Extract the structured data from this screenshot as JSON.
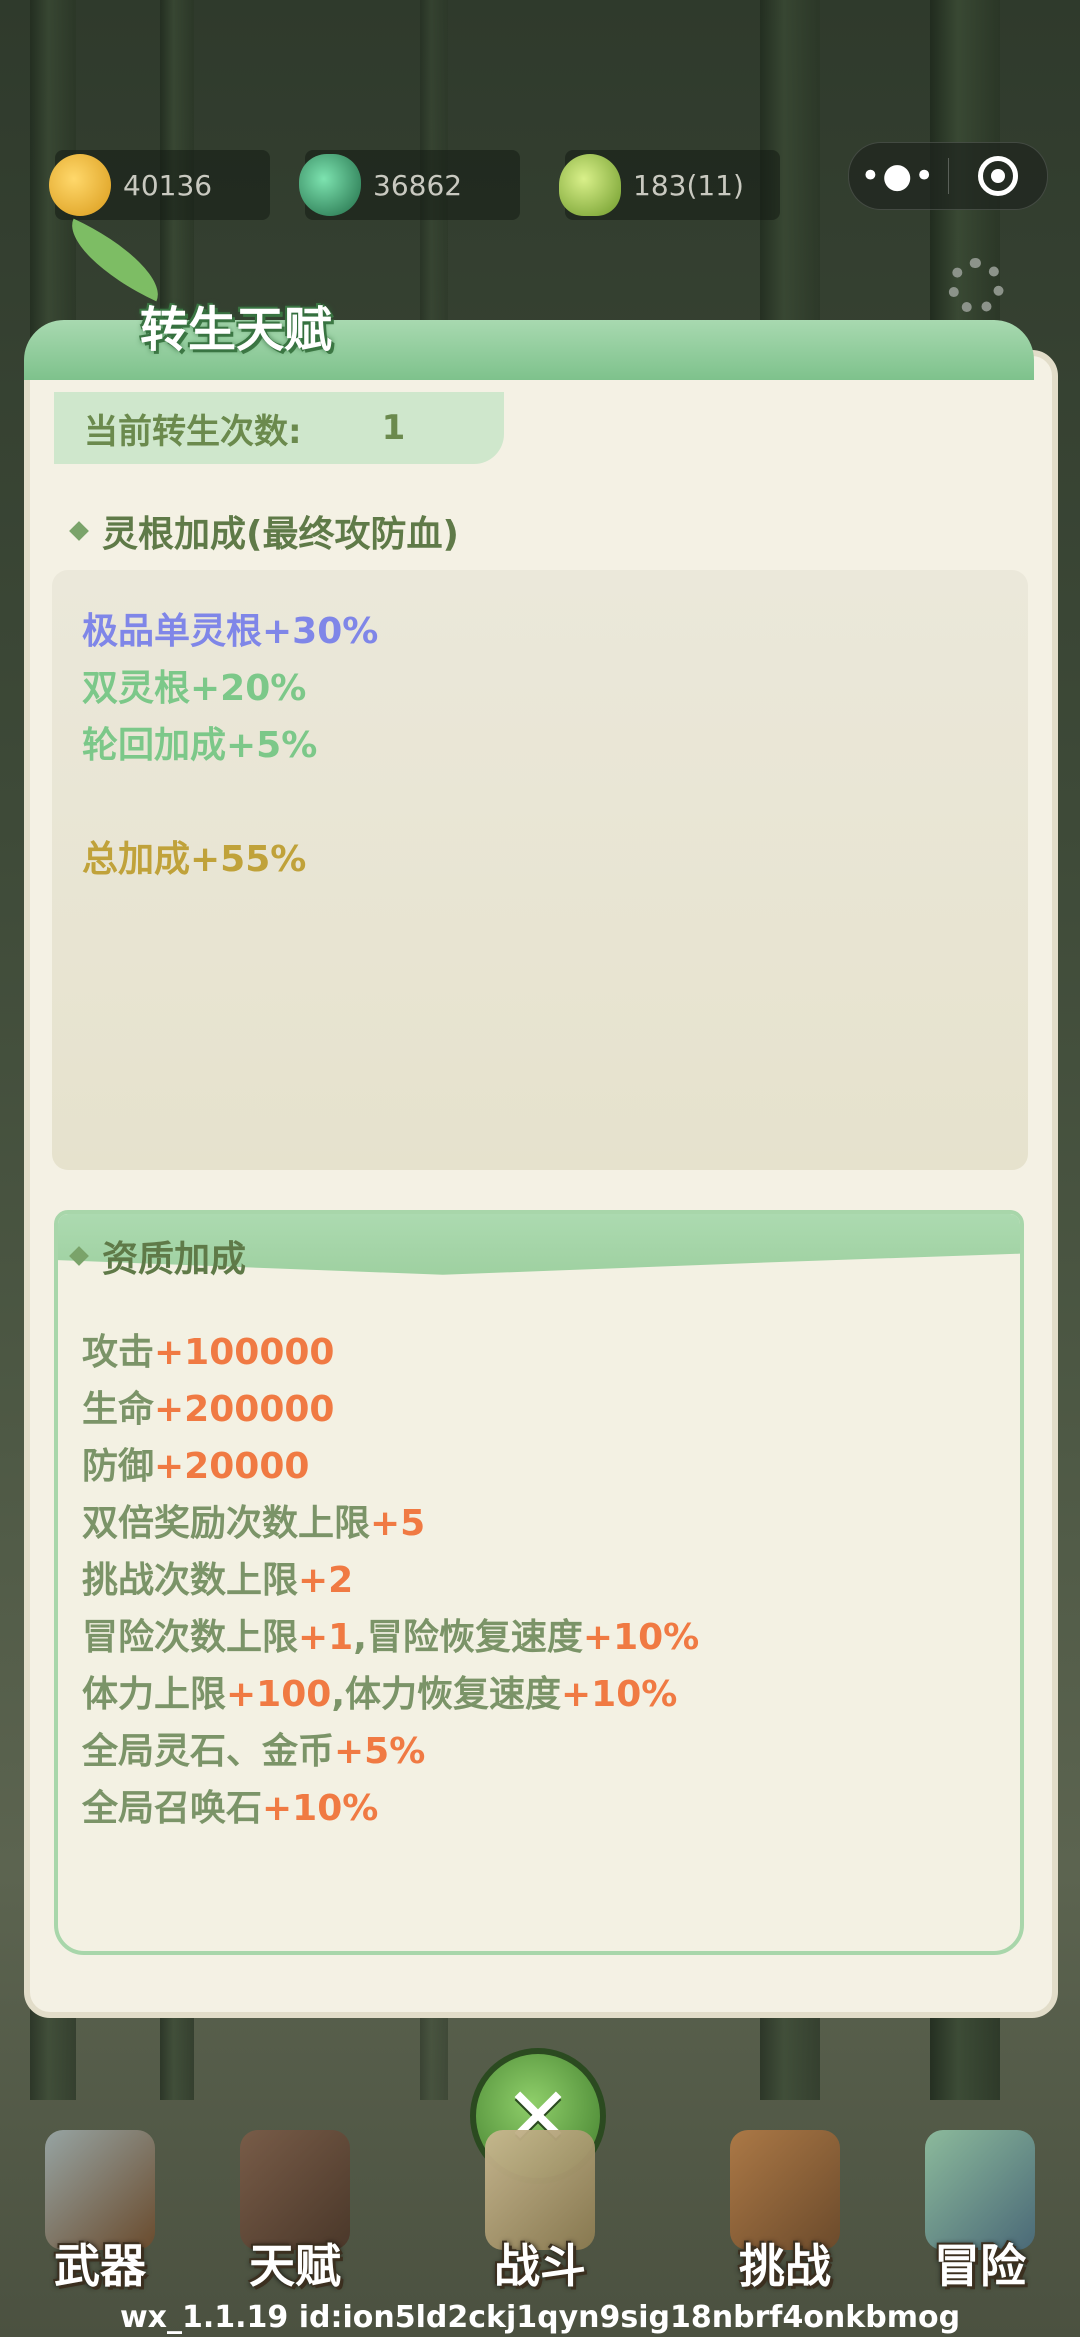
{
  "resources": {
    "gold": "40136",
    "spirit_stone": "36862",
    "bamboo": "183(11)"
  },
  "panel": {
    "title": "转生天赋",
    "rebirth_label": "当前转生次数:",
    "rebirth_value": "1",
    "root_section": {
      "heading": "灵根加成(最终攻防血)",
      "lines": [
        {
          "name": "极品单灵根",
          "bonus": "+30%",
          "color": "#7f86e8"
        },
        {
          "name": "双灵根",
          "bonus": "+20%",
          "color": "#7cc889"
        },
        {
          "name": "轮回加成",
          "bonus": "+5%",
          "color": "#7cc889"
        }
      ],
      "total": {
        "name": "总加成",
        "bonus": "+55%",
        "color": "#c0a23a"
      }
    },
    "aptitude_section": {
      "heading": "资质加成",
      "lines": [
        {
          "parts": [
            "攻击",
            "+100000"
          ]
        },
        {
          "parts": [
            "生命",
            "+200000"
          ]
        },
        {
          "parts": [
            "防御",
            "+20000"
          ]
        },
        {
          "parts": [
            "双倍奖励次数上限",
            "+5"
          ]
        },
        {
          "parts": [
            "挑战次数上限",
            "+2"
          ]
        },
        {
          "parts": [
            "冒险次数上限",
            "+1",
            ",冒险恢复速度",
            "+10%"
          ]
        },
        {
          "parts": [
            "体力上限",
            "+100",
            ",体力恢复速度",
            "+10%"
          ]
        },
        {
          "parts": [
            "全局灵石、金币",
            "+5%"
          ]
        },
        {
          "parts": [
            "全局召唤石",
            "+10%"
          ]
        }
      ],
      "label_color": "#7b9468",
      "value_color": "#f07a43"
    }
  },
  "nav": {
    "weapon": "武器",
    "talent": "天赋",
    "battle": "战斗",
    "challenge": "挑战",
    "adventure": "冒险"
  },
  "footer": "wx_1.1.19 id:ion5ld2ckj1qyn9sig18nbrf4onkbmog",
  "colors": {
    "panel_bg": "#f4f1e4",
    "accent_green": "#a8d6aa"
  },
  "icons": {
    "capsule_more": "more-dots-icon",
    "capsule_close": "target-icon",
    "settings": "gear-icon",
    "close": "close-icon"
  }
}
